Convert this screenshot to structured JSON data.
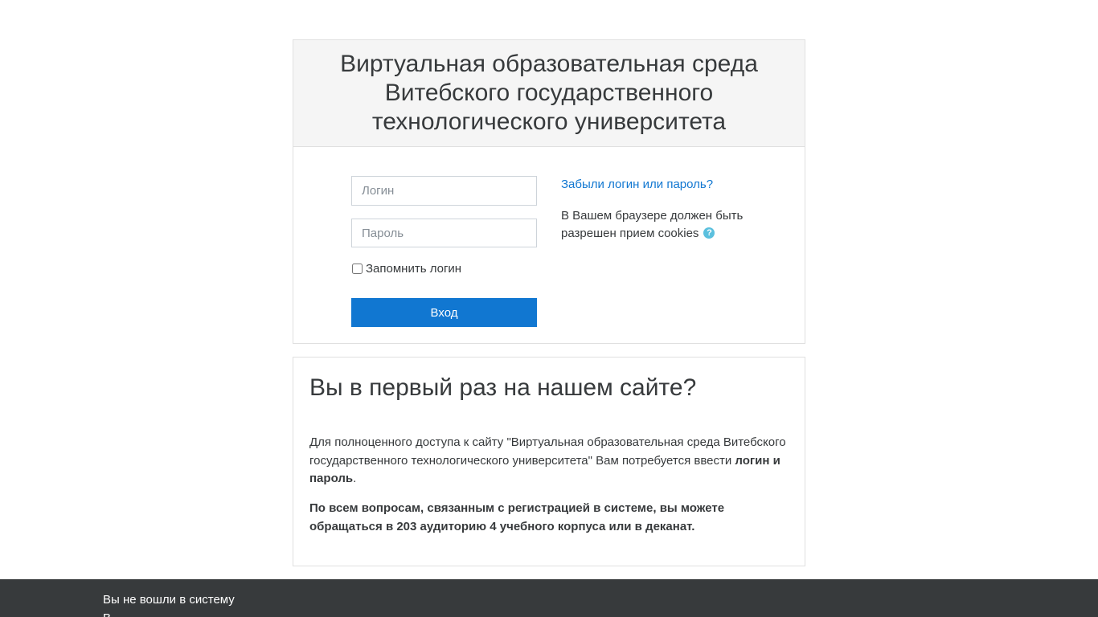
{
  "login": {
    "title": "Виртуальная образовательная среда Витебского государственного технологического университета",
    "username_placeholder": "Логин",
    "username_value": "",
    "password_placeholder": "Пароль",
    "password_value": "",
    "remember_label": "Запомнить логин",
    "remember_checked": false,
    "submit_label": "Вход",
    "forgot_link": "Забыли логин или пароль?",
    "cookies_note": "В Вашем браузере должен быть разрешен прием cookies",
    "help_icon": "question-circle-icon",
    "help_glyph": "?"
  },
  "signup": {
    "heading": "Вы в первый раз на нашем сайте?",
    "text_intro": "Для полноценного доступа к сайту \"Виртуальная образовательная среда Витебского государственного технологического университета\" Вам потребуется ввести ",
    "text_bold": "логин и пароль",
    "text_end": ".",
    "note": "По всем вопросам, связанным с регистрацией в системе, вы можете обращаться в 203 аудиторию 4 учебного корпуса или в деканат."
  },
  "footer": {
    "login_status": "Вы не вошли в систему",
    "second_line": "В"
  },
  "colors": {
    "primary": "#1177d1",
    "footer_bg": "#373a3c",
    "header_bg": "#f5f5f5",
    "help_icon": "#5bc0de"
  }
}
